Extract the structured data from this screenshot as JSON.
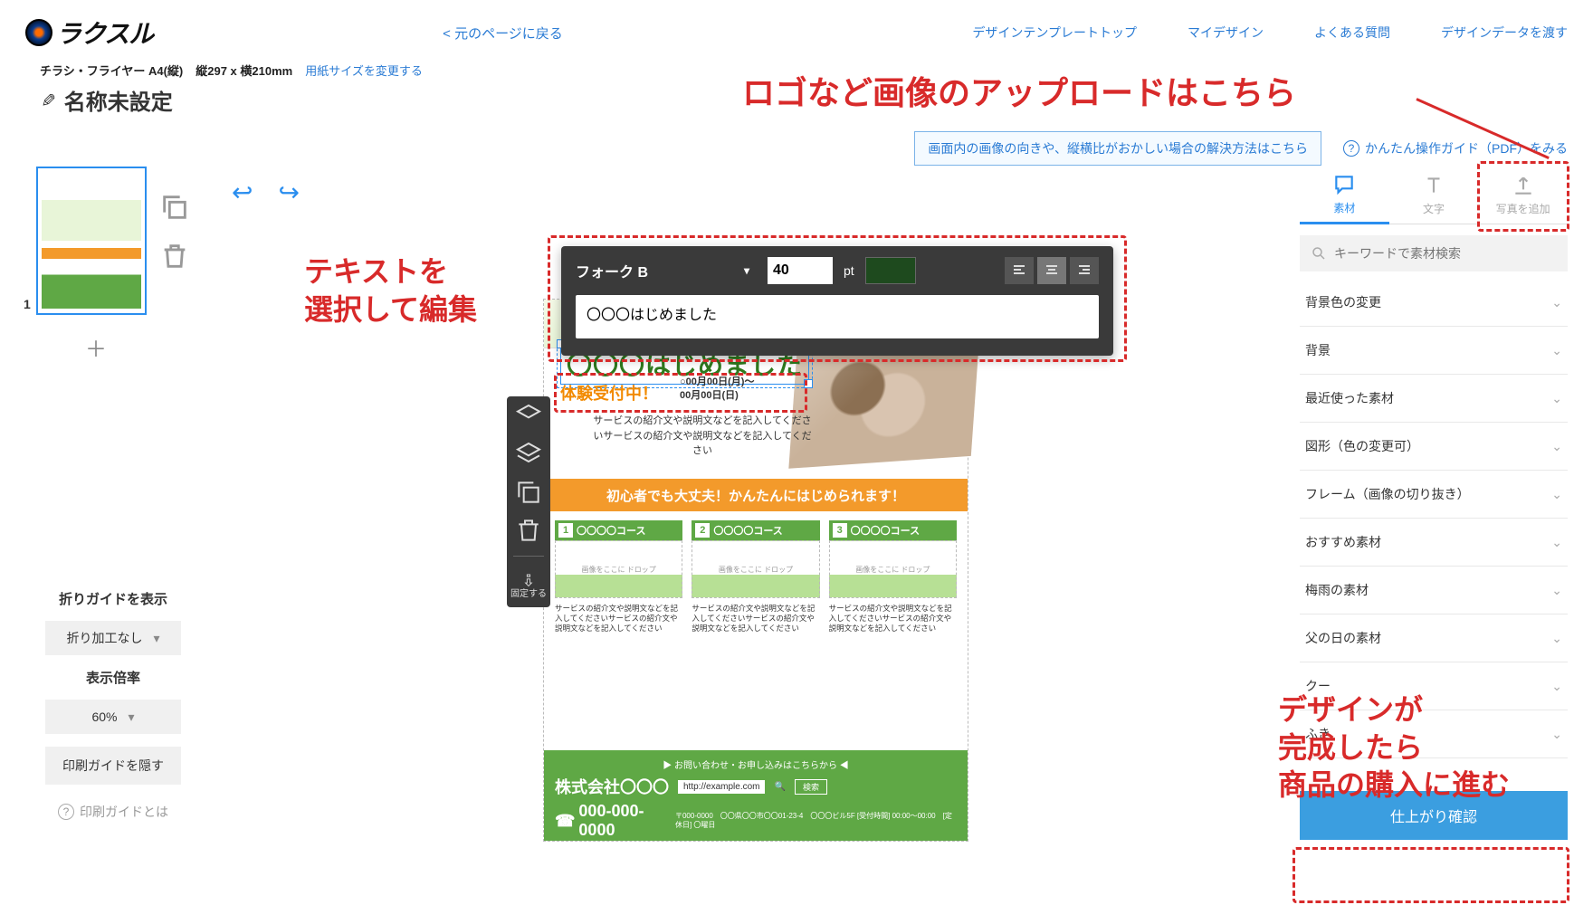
{
  "header": {
    "logo_text": "ラクスル",
    "back_link": "< 元のページに戻る",
    "links": [
      "デザインテンプレートトップ",
      "マイデザイン",
      "よくある質問",
      "デザインデータを渡す"
    ]
  },
  "sub": {
    "product": "チラシ・フライヤー A4(縦)",
    "dims": "縦297 x 横210mm",
    "change": "用紙サイズを変更する"
  },
  "title": "名称未設定",
  "info": {
    "notice": "画面内の画像の向きや、縦横比がおかしい場合の解決方法はこちら",
    "help": "かんたん操作ガイド（PDF）をみる"
  },
  "left": {
    "page_number": "1",
    "fold_label": "折りガイドを表示",
    "fold_value": "折り加工なし",
    "zoom_label": "表示倍率",
    "zoom_value": "60%",
    "hide_guide": "印刷ガイドを隠す",
    "guide_help": "印刷ガイドとは"
  },
  "right": {
    "tabs": [
      "素材",
      "文字",
      "写真を追加"
    ],
    "search_placeholder": "キーワードで素材検索",
    "acc": [
      "背景色の変更",
      "背景",
      "最近使った素材",
      "図形（色の変更可）",
      "フレーム（画像の切り抜き）",
      "おすすめ素材",
      "梅雨の素材",
      "父の日の素材",
      "クー",
      "ふき"
    ],
    "confirm": "仕上がり確認"
  },
  "toolbar": {
    "font": "フォーク B",
    "size": "40",
    "pt": "pt",
    "text_value": "〇〇〇はじめました"
  },
  "sidetool": {
    "lock": "固定する"
  },
  "canvas": {
    "selected": "〇〇〇はじめました",
    "trial": "体験受付中！",
    "date1": "○00月00日(月)～",
    "date2": "00月00日(日)",
    "intro": "サービスの紹介文や説明文などを記入してくださいサービスの紹介文や説明文などを記入してください",
    "orange": "初心者でも大丈夫！かんたんにはじめられます！",
    "course_head": "〇〇〇〇コース",
    "course_drop": "画像をここに\nドロップ",
    "course_desc": "サービスの紹介文や説明文などを記入してくださいサービスの紹介文や説明文などを記入してください",
    "footer_head": "お問い合わせ・お申し込みはこちらから",
    "company": "株式会社〇〇〇",
    "url": "http://example.com",
    "search": "検索",
    "phone": "000-000-0000",
    "addr": "〒000-0000　〇〇県〇〇市〇〇01-23-4　〇〇〇ビル5F\n[受付時間] 00:00～00:00　[定休日] 〇曜日"
  },
  "ann": {
    "upload": "ロゴなど画像のアップロードはこちら",
    "edit1": "テキストを",
    "edit2": "選択して編集",
    "done1": "デザインが",
    "done2": "完成したら",
    "done3": "商品の購入に進む"
  }
}
